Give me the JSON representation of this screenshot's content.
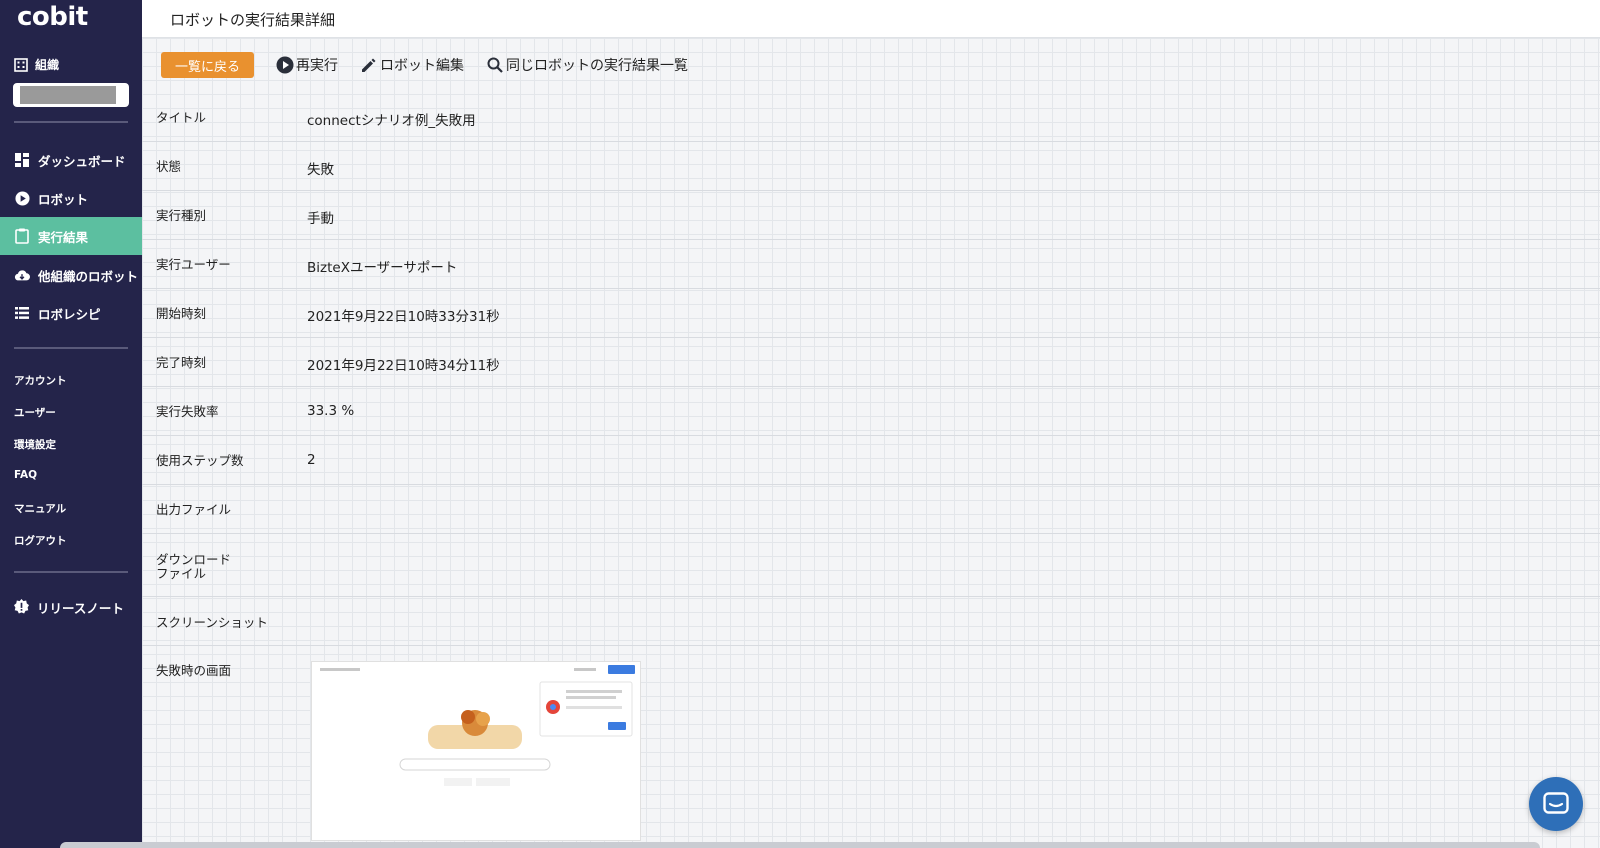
{
  "app": {
    "logo": "cobit"
  },
  "sidebar": {
    "org_label": "組織",
    "main_items": [
      {
        "label": "ダッシュボード",
        "icon": "dashboard-icon"
      },
      {
        "label": "ロボット",
        "icon": "play-circle-icon"
      },
      {
        "label": "実行結果",
        "icon": "clipboard-icon",
        "active": true
      },
      {
        "label": "他組織のロボット",
        "icon": "cloud-download-icon"
      },
      {
        "label": "ロボレシピ",
        "icon": "list-icon"
      }
    ],
    "sub_items": [
      "アカウント",
      "ユーザー",
      "環境設定",
      "FAQ",
      "マニュアル",
      "ログアウト"
    ],
    "release_notes": "リリースノート"
  },
  "header": {
    "title": "ロボットの実行結果詳細"
  },
  "toolbar": {
    "back_label": "一覧に戻る",
    "rerun_label": "再実行",
    "edit_label": "ロボット編集",
    "list_label": "同じロボットの実行結果一覧"
  },
  "details": [
    {
      "label": "タイトル",
      "value": "connectシナリオ例_失敗用"
    },
    {
      "label": "状態",
      "value": "失敗"
    },
    {
      "label": "実行種別",
      "value": "手動"
    },
    {
      "label": "実行ユーザー",
      "value": "BizteXユーザーサポート"
    },
    {
      "label": "開始時刻",
      "value": "2021年9月22日10時33分31秒"
    },
    {
      "label": "完了時刻",
      "value": "2021年9月22日10時34分11秒"
    },
    {
      "label": "実行失敗率",
      "value": "33.3 %"
    },
    {
      "label": "使用ステップ数",
      "value": "2"
    },
    {
      "label": "出力ファイル",
      "value": ""
    },
    {
      "label": "ダウンロードファイル",
      "value": ""
    },
    {
      "label": "スクリーンショット",
      "value": ""
    },
    {
      "label": "失敗時の画面",
      "value": ""
    }
  ],
  "colors": {
    "sidebar_bg": "#24244a",
    "active_nav": "#5cbfa0",
    "back_button": "#e9912f",
    "chat_button": "#2e6fb8"
  }
}
